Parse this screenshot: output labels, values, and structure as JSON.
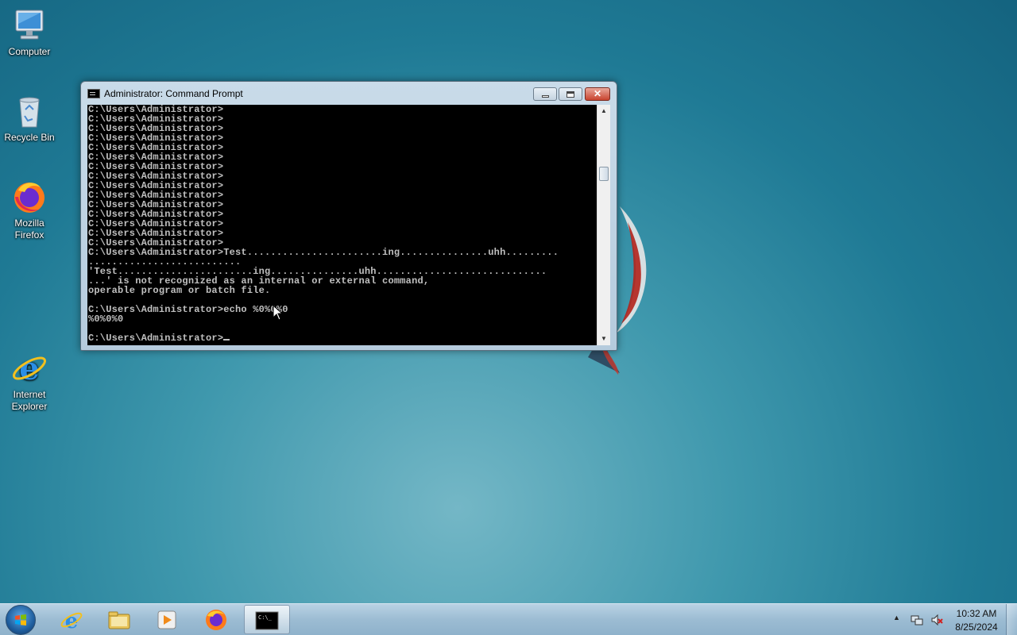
{
  "desktop": {
    "icons": [
      {
        "label": "Computer",
        "icon": "computer-icon"
      },
      {
        "label": "Recycle Bin",
        "icon": "recycle-bin-icon"
      },
      {
        "label": "Mozilla Firefox",
        "icon": "firefox-icon"
      },
      {
        "label": "Internet Explorer",
        "icon": "internet-explorer-icon"
      }
    ]
  },
  "window": {
    "title": "Administrator: Command Prompt",
    "controls": {
      "minimize": "minimize-icon",
      "maximize": "maximize-icon",
      "close": "✕"
    },
    "console_lines": [
      "C:\\Users\\Administrator>",
      "C:\\Users\\Administrator>",
      "C:\\Users\\Administrator>",
      "C:\\Users\\Administrator>",
      "C:\\Users\\Administrator>",
      "C:\\Users\\Administrator>",
      "C:\\Users\\Administrator>",
      "C:\\Users\\Administrator>",
      "C:\\Users\\Administrator>",
      "C:\\Users\\Administrator>",
      "C:\\Users\\Administrator>",
      "C:\\Users\\Administrator>",
      "C:\\Users\\Administrator>",
      "C:\\Users\\Administrator>",
      "C:\\Users\\Administrator>",
      "C:\\Users\\Administrator>Test.......................ing...............uhh.........",
      "..........................",
      "'Test.......................ing...............uhh.............................",
      "...' is not recognized as an internal or external command,",
      "operable program or batch file.",
      "",
      "C:\\Users\\Administrator>echo %0%0%0",
      "%0%0%0",
      "",
      "C:\\Users\\Administrator>"
    ]
  },
  "taskbar": {
    "start": "windows-start-icon",
    "pinned": [
      {
        "name": "internet-explorer",
        "icon": "internet-explorer-icon"
      },
      {
        "name": "windows-explorer",
        "icon": "folder-icon"
      },
      {
        "name": "media-player",
        "icon": "media-player-icon"
      },
      {
        "name": "firefox",
        "icon": "firefox-icon"
      },
      {
        "name": "command-prompt",
        "icon": "cmd-icon",
        "active": true
      }
    ],
    "tray": {
      "time": "10:32 AM",
      "date": "8/25/2024"
    }
  },
  "colors": {
    "console_bg": "#000000",
    "console_text": "#c0c0c0",
    "close_button": "#c9442f",
    "desktop_bg": "#2a86a0"
  }
}
